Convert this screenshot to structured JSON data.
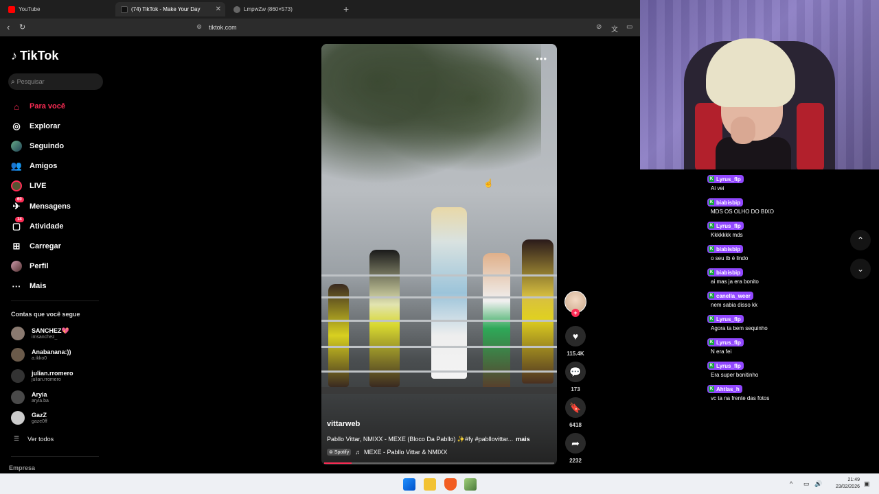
{
  "browser": {
    "tabs": [
      {
        "label": "YouTube"
      },
      {
        "label": "(74) TikTok - Make Your Day"
      },
      {
        "label": "LmpwZw (860×573)"
      }
    ],
    "url": "tiktok.com"
  },
  "sidebar": {
    "logo": "TikTok",
    "search_placeholder": "Pesquisar",
    "items": [
      {
        "label": "Para você",
        "icon": "home-icon"
      },
      {
        "label": "Explorar",
        "icon": "compass-icon"
      },
      {
        "label": "Seguindo",
        "icon": "following-avatar-icon"
      },
      {
        "label": "Amigos",
        "icon": "friends-icon"
      },
      {
        "label": "LIVE",
        "icon": "live-icon"
      },
      {
        "label": "Mensagens",
        "icon": "messages-icon",
        "badge": "60"
      },
      {
        "label": "Atividade",
        "icon": "activity-icon",
        "badge": "14"
      },
      {
        "label": "Carregar",
        "icon": "upload-icon"
      },
      {
        "label": "Perfil",
        "icon": "profile-icon"
      },
      {
        "label": "Mais",
        "icon": "more-icon"
      }
    ],
    "following_title": "Contas que você segue",
    "following": [
      {
        "name": "SANCHEZ💖",
        "handle": "imsanchez_"
      },
      {
        "name": "Anabanana:))",
        "handle": "a.ikko0"
      },
      {
        "name": "julian.rromero",
        "handle": "julian.rromero"
      },
      {
        "name": "Aryia",
        "handle": "aryia.ba"
      },
      {
        "name": "GazZ",
        "handle": "gaze0ff"
      }
    ],
    "see_all": "Ver todos",
    "footer": "Empresa"
  },
  "video": {
    "author": "vittarweb",
    "description": "Pabllo Vittar, NMIXX - MEXE (Bloco Da Pabllo) ✨#fy #pabllovittar...",
    "more": "mais",
    "music_source": "Spotify",
    "music": "MEXE - Pabllo Vittar & NMIXX",
    "progress": 0.12,
    "likes": "115.4K",
    "comments": "173",
    "saves": "6418",
    "shares": "2232"
  },
  "chat": [
    {
      "user": "Lyrus_flp",
      "text": "Ai vei",
      "color": "#9147ff"
    },
    {
      "user": "biabisbip",
      "text": "MDS OS OLHO DO BIXO",
      "color": "#9147ff"
    },
    {
      "user": "Lyrus_flp",
      "text": "Kkkkkkk mds",
      "color": "#9147ff"
    },
    {
      "user": "biabisbip",
      "text": "o seu tb é lindo",
      "color": "#9147ff"
    },
    {
      "user": "biabisbip",
      "text": "ai mas ja era bonito",
      "color": "#9147ff"
    },
    {
      "user": "canella_weer",
      "text": "nem sabia disso kk",
      "color": "#9147ff"
    },
    {
      "user": "Lyrus_flp",
      "text": "Agora ta bem sequinho",
      "color": "#9147ff"
    },
    {
      "user": "Lyrus_flp",
      "text": "N era fei",
      "color": "#9147ff"
    },
    {
      "user": "Lyrus_flp",
      "text": "Era super bonitinho",
      "color": "#9147ff"
    },
    {
      "user": "Ahtlas_h",
      "text": "vc ta na frente das fotos",
      "color": "#9147ff"
    }
  ],
  "taskbar": {
    "time": "21:49",
    "date": "23/02/2026"
  }
}
